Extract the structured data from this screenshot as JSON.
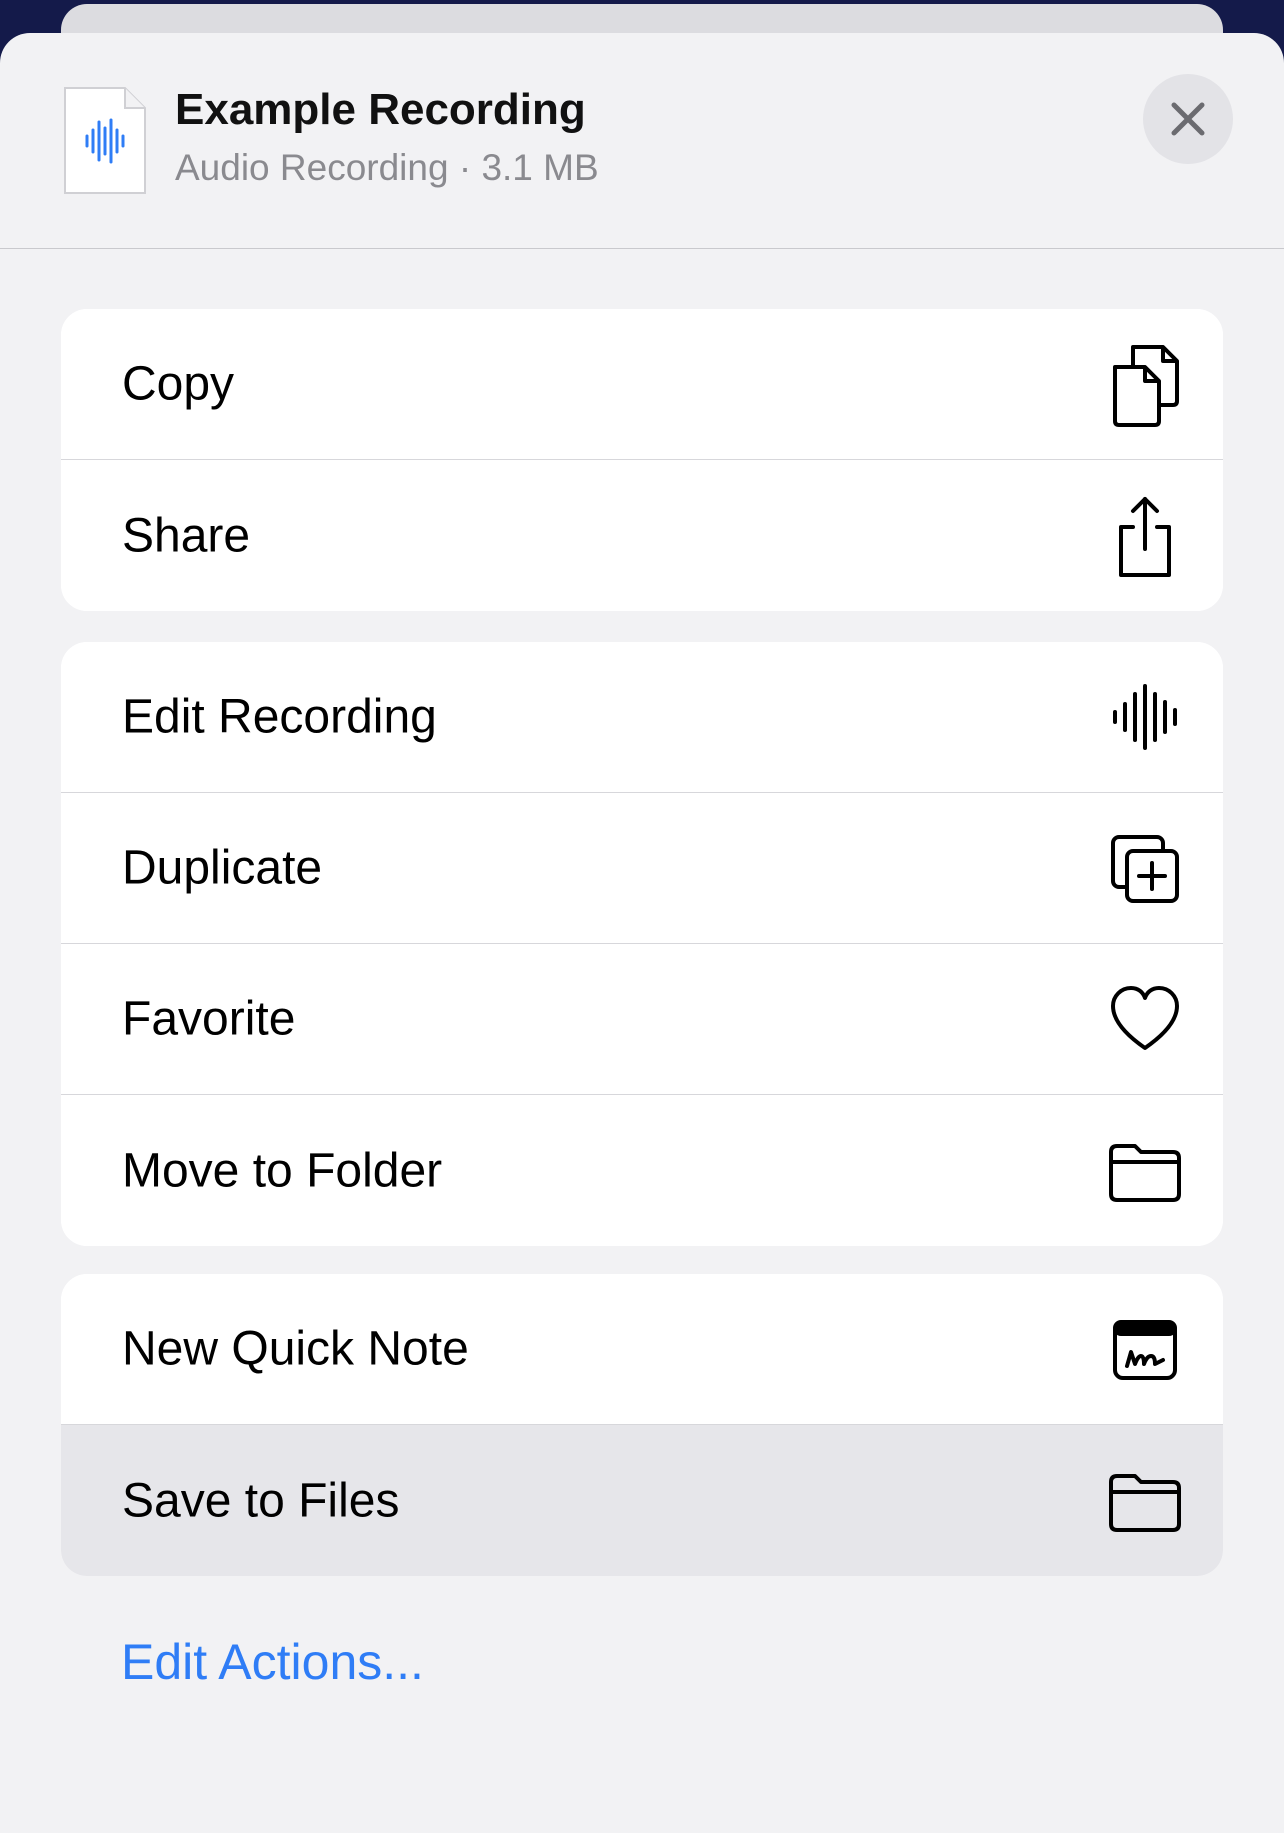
{
  "header": {
    "title": "Example Recording",
    "subtitle": "Audio Recording · 3.1 MB",
    "file_icon": "audio-waveform-file-icon",
    "close_icon": "close-icon"
  },
  "groups": [
    {
      "items": [
        {
          "label": "Copy",
          "icon": "copy-icon"
        },
        {
          "label": "Share",
          "icon": "share-icon"
        }
      ]
    },
    {
      "items": [
        {
          "label": "Edit Recording",
          "icon": "waveform-icon"
        },
        {
          "label": "Duplicate",
          "icon": "duplicate-icon"
        },
        {
          "label": "Favorite",
          "icon": "heart-icon"
        },
        {
          "label": "Move to Folder",
          "icon": "folder-icon"
        }
      ]
    },
    {
      "items": [
        {
          "label": "New Quick Note",
          "icon": "quick-note-icon"
        },
        {
          "label": "Save to Files",
          "icon": "folder-icon",
          "highlighted": true
        }
      ]
    }
  ],
  "footer": {
    "edit_actions_label": "Edit Actions..."
  },
  "colors": {
    "accent": "#2f7df6",
    "sheet_background": "#f2f2f4",
    "highlight_row": "#e6e6ea",
    "backdrop": "#141a4a"
  }
}
